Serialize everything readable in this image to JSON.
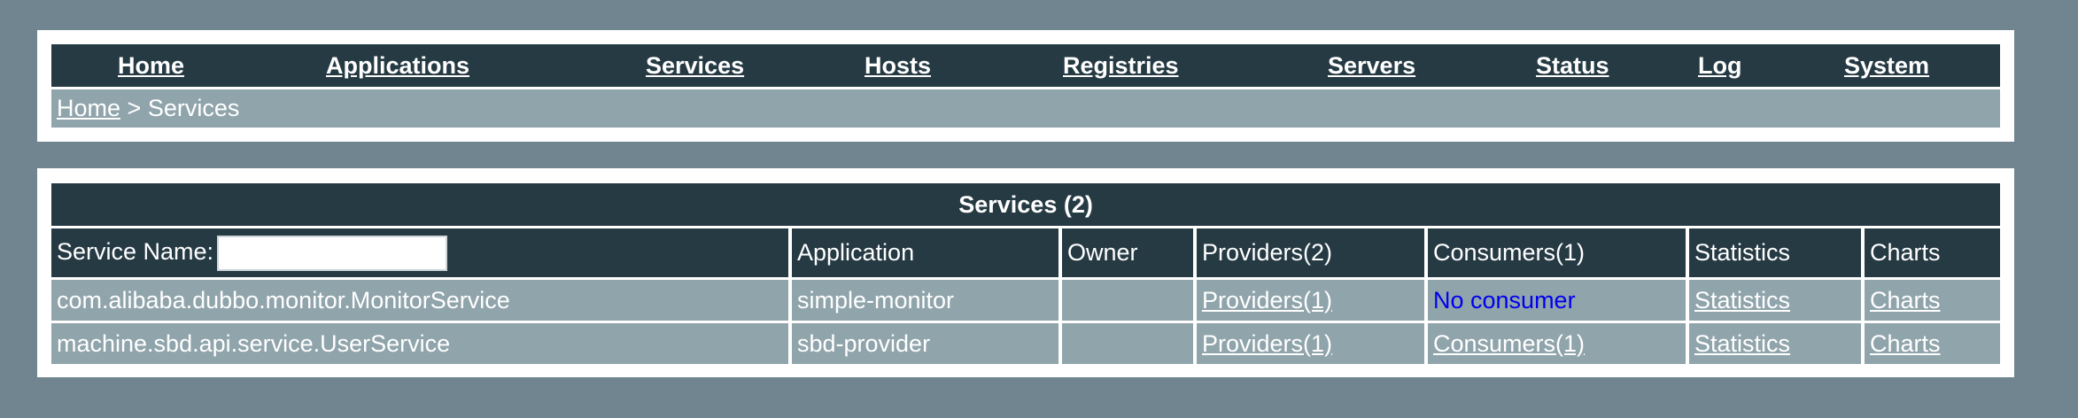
{
  "nav": {
    "items": [
      {
        "label": "Home"
      },
      {
        "label": "Applications"
      },
      {
        "label": "Services"
      },
      {
        "label": "Hosts"
      },
      {
        "label": "Registries"
      },
      {
        "label": "Servers"
      },
      {
        "label": "Status"
      },
      {
        "label": "Log"
      },
      {
        "label": "System"
      }
    ]
  },
  "breadcrumb": {
    "home": "Home",
    "separator": " > ",
    "current": "Services"
  },
  "services": {
    "title": "Services (2)",
    "search_label": "Service Name:",
    "search_value": "",
    "headers": {
      "application": "Application",
      "owner": "Owner",
      "providers": "Providers(2)",
      "consumers": "Consumers(1)",
      "statistics": "Statistics",
      "charts": "Charts"
    },
    "rows": [
      {
        "service": "com.alibaba.dubbo.monitor.MonitorService",
        "application": "simple-monitor",
        "owner": "",
        "providers": "Providers(1)",
        "consumers": "No consumer",
        "statistics": "Statistics",
        "charts": "Charts"
      },
      {
        "service": "machine.sbd.api.service.UserService",
        "application": "sbd-provider",
        "owner": "",
        "providers": "Providers(1)",
        "consumers": "Consumers(1)",
        "statistics": "Statistics",
        "charts": "Charts"
      }
    ]
  },
  "colors": {
    "page_background": "#708590",
    "dark_header": "#263a44",
    "row_background": "#90a4ab",
    "no_consumer_text": "#0000ee"
  }
}
